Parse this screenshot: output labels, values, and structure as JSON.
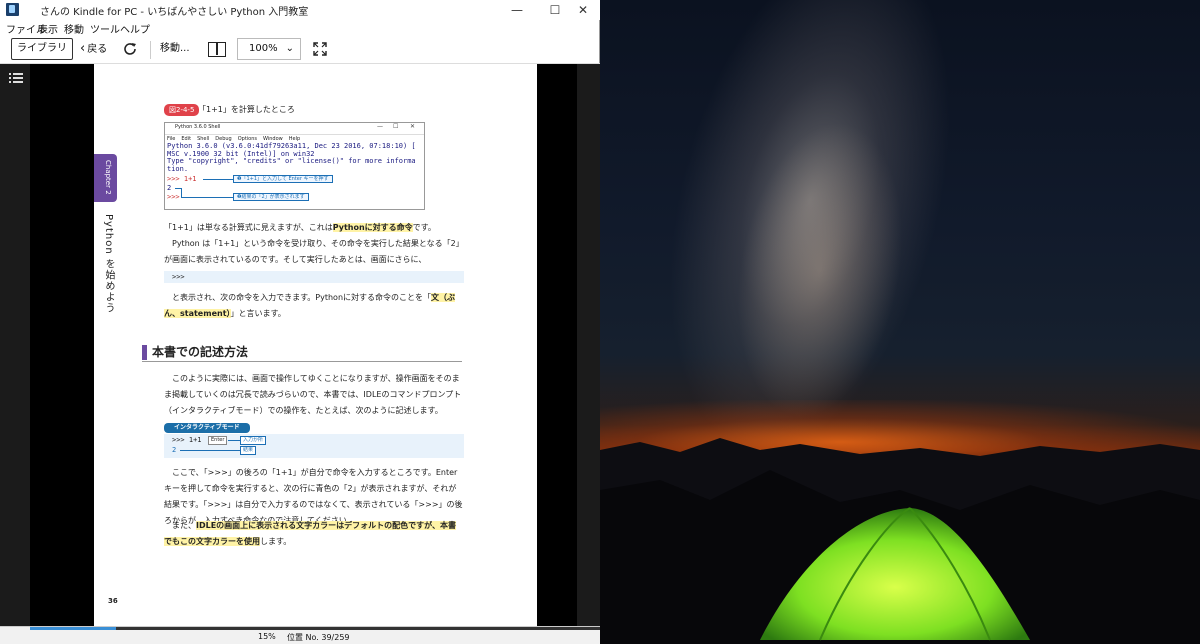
{
  "window": {
    "title": "さんの Kindle for PC - いちばんやさしい Python 入門教室",
    "controls": {
      "minimize": "—",
      "maximize": "☐",
      "close": "✕"
    }
  },
  "menubar": [
    "ファイル",
    "表示",
    "移動",
    "ツール",
    "ヘルプ"
  ],
  "toolbar": {
    "library_label": "ライブラリ",
    "back_label": "戻る",
    "goto_label": "移動...",
    "zoom_value": "100%"
  },
  "page": {
    "chapter_tab": "Chapter 2",
    "vertical_title": "Python を始めよう",
    "figure_label": "図2-4-5",
    "figure_caption": "「1+1」を計算したところ",
    "shell": {
      "title": "Python 3.6.0 Shell",
      "menu": [
        "File",
        "Edit",
        "Shell",
        "Debug",
        "Options",
        "Window",
        "Help"
      ],
      "output_lines": [
        "Python 3.6.0 (v3.6.0:41df79263a11, Dec 23 2016, 07:18:10) [",
        "MSC v.1900 32 bit (Intel)] on win32",
        "Type \"copyright\", \"credits\" or \"license()\" for more informa",
        "tion."
      ],
      "input_line": ">>> 1+1",
      "result_line": "2",
      "prompt_line": ">>>",
      "callout_1": "❶「1+1」と入力して Enter キーを押す",
      "callout_2": "❷結果の「2」が表示されます"
    },
    "para1": {
      "before": "「1+1」は単なる計算式に見えますが、これは",
      "highlight": "Pythonに対する命令",
      "after": "です。"
    },
    "para2": "Python は「1+1」という命令を受け取り、その命令を実行した結果となる「2」が画面に表示されているのです。そして実行したあとは、画面にさらに、",
    "code1": ">>>",
    "para3": {
      "before": "と表示され、次の命令を入力できます。Pythonに対する命令のことを「",
      "highlight": "文（ぶん、statement）",
      "after": "」と言います。"
    },
    "section_title": "本書での記述方法",
    "para4": "このように実際には、画面で操作してゆくことになりますが、操作画面をそのまま掲載していくのは冗長で読みづらいので、本書では、IDLEのコマンドプロンプト（インタラクティブモード）での操作を、たとえば、次のように記述します。",
    "mode_badge": "インタラクティブモード",
    "code2": {
      "input": ">>> 1+1",
      "enter_key": "Enter",
      "input_label": "入力か所",
      "result": "2",
      "result_label": "結果"
    },
    "para5": "ここで、「>>>」の後ろの「1+1」が自分で命令を入力するところです。Enter キーを押して命令を実行すると、次の行に青色の「2」が表示されますが、それが結果です。「>>>」は自分で入力するのではなくて、表示されている「>>>」の後ろからが、入力すべき命令なので注意してください。",
    "para6": {
      "before": "また、",
      "highlight": "IDLEの画面上に表示される文字カラーはデフォルトの配色ですが、本書でもこの文字カラーを使用",
      "after": "します。"
    },
    "page_number": "36"
  },
  "status": {
    "percent": "15%",
    "location": "位置 No. 39/259",
    "progress_fraction": 0.15
  },
  "colors": {
    "accent_purple": "#6b4aa0",
    "figure_red": "#e0424a",
    "shell_blue": "#1c6fb5",
    "highlight_yellow": "#fff3a6",
    "progress_blue": "#3a8fd6"
  }
}
